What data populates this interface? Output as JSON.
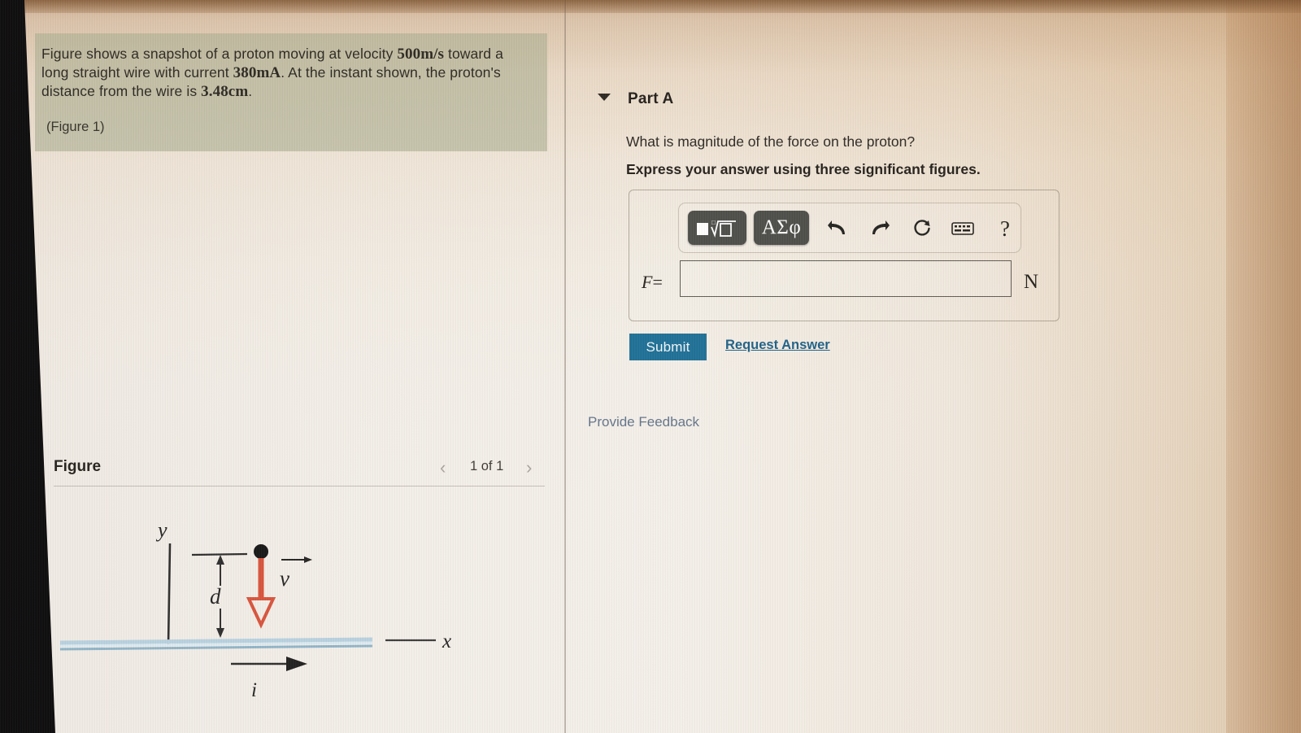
{
  "problem": {
    "line1_a": "Figure shows a snapshot of a proton moving at velocity ",
    "velocity": "500m/s",
    "line1_b": " toward a long straight wire with current ",
    "current": "380mA",
    "line1_c": ". At the instant shown, the proton's distance from the wire is ",
    "distance": "3.48cm",
    "line1_d": ".",
    "figure_ref": "(Figure 1)"
  },
  "part": {
    "caret_icon": "triangle-down-icon",
    "title": "Part A",
    "question": "What is magnitude of the force on the proton?",
    "instruction": "Express your answer using three significant figures."
  },
  "answer": {
    "toolbar": {
      "template_button_label": "math-template",
      "greek_button_label": "ΑΣφ",
      "undo_icon": "↰",
      "redo_icon": "↱",
      "reset_icon": "↻",
      "keyboard_icon": "⌨",
      "help_icon": "?"
    },
    "field_label": "F",
    "field_equals": "=",
    "field_value": "",
    "field_placeholder": "",
    "unit": "N"
  },
  "actions": {
    "submit_label": "Submit",
    "request_answer_label": "Request Answer",
    "provide_feedback_label": "Provide Feedback"
  },
  "figure": {
    "title": "Figure",
    "prev_icon": "‹",
    "next_icon": "›",
    "counter": "1 of 1",
    "labels": {
      "y_axis": "y",
      "x_axis": "x",
      "distance": "d",
      "velocity": "v",
      "current": "i"
    },
    "colors": {
      "wire": "#9fc0d2",
      "velocity_arrow": "#d8523a",
      "proton": "#141414",
      "axis": "#2b2b2b"
    }
  },
  "theme": {
    "submit_button_color": "#1b6e96",
    "link_color": "#1b5f86",
    "feedback_color": "#61738a",
    "problem_highlight": "#abaf92",
    "toolbar_button_color": "#4b4c48"
  }
}
